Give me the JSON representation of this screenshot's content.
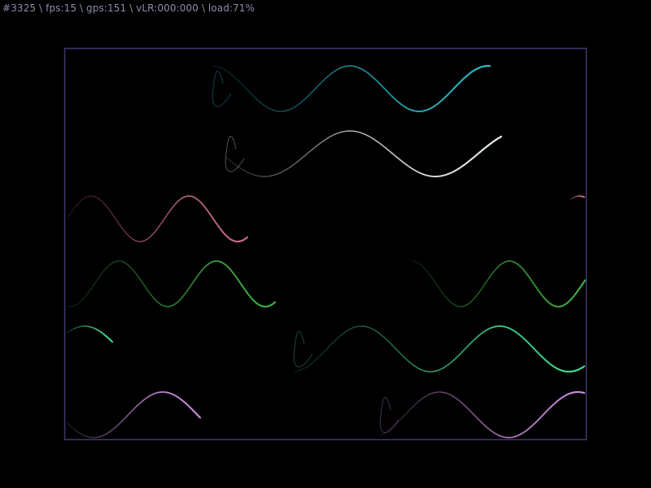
{
  "status": {
    "text": "#3325 \\ fps:15 \\ gps:151 \\ vLR:000:000 \\ load:71%"
  },
  "colors": {
    "background": "#000000",
    "frame": "#3d3a6e",
    "status_text": "#8a8fa8"
  },
  "waves": [
    {
      "name": "cyan",
      "color": "#2fb8c8"
    },
    {
      "name": "white",
      "color": "#e6f2e8"
    },
    {
      "name": "pink",
      "color": "#c86a90"
    },
    {
      "name": "green",
      "color": "#3fae42"
    },
    {
      "name": "mint",
      "color": "#45d690"
    },
    {
      "name": "violet",
      "color": "#c58ad8"
    }
  ]
}
